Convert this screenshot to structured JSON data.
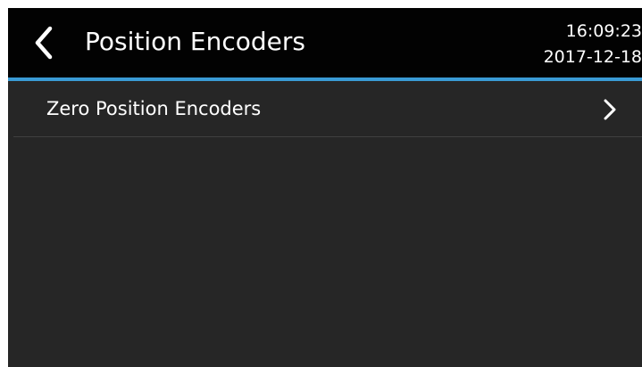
{
  "header": {
    "title": "Position Encoders",
    "time": "16:09:23",
    "date": "2017-12-18",
    "back_icon": "chevron-left-icon",
    "accent_color": "#3a9bd5",
    "background_color": "#020202"
  },
  "list": {
    "items": [
      {
        "label": "Zero Position Encoders",
        "icon": "chevron-right-icon"
      }
    ]
  },
  "screen": {
    "background_color": "#262626"
  }
}
